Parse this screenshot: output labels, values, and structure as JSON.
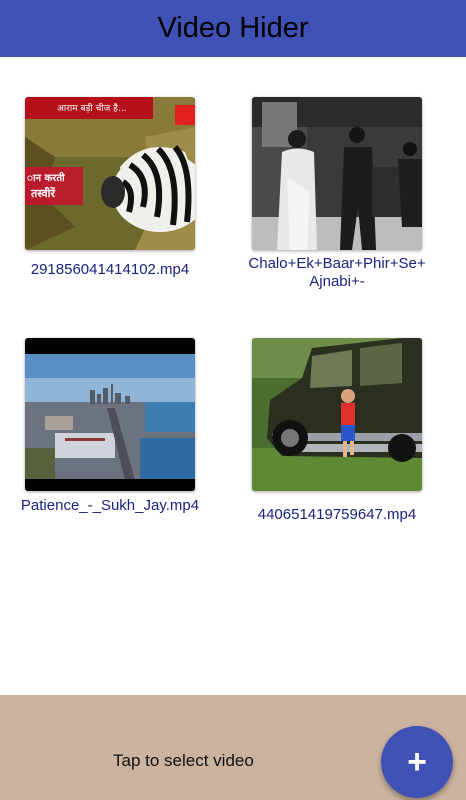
{
  "app": {
    "title": "Video Hider"
  },
  "videos": [
    {
      "filename": "291856041414102.mp4",
      "thumbnail_icon": "zebra-thumbnail"
    },
    {
      "filename": "Chalo+Ek+Baar+Phir+Se+Ajnabi+-",
      "thumbnail_icon": "classic-film-thumbnail"
    },
    {
      "filename": "Patience_-_Sukh_Jay.mp4",
      "thumbnail_icon": "city-skyline-thumbnail"
    },
    {
      "filename": "440651419759647.mp4",
      "thumbnail_icon": "truck-child-thumbnail"
    }
  ],
  "thumb_text": {
    "zebra_top": "आराम बड़ी चीज है...",
    "zebra_side1": "ान करती",
    "zebra_side2": "तस्वीरें"
  },
  "bottom": {
    "hint": "Tap to select video"
  },
  "fab": {
    "label": "+",
    "icon": "plus-icon"
  },
  "colors": {
    "primary": "#3f51b5",
    "bottom_bar": "#cbb39f",
    "filename_text": "#1a237e"
  }
}
